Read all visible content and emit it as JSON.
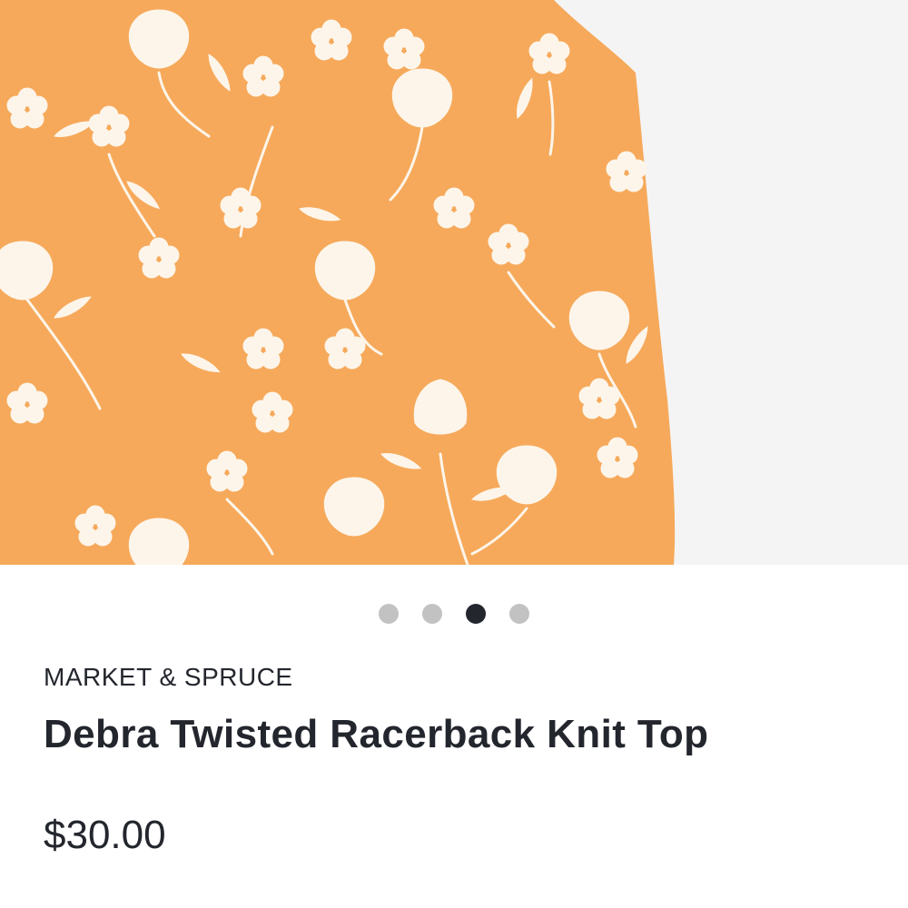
{
  "product_image": {
    "alt_subject": "orange floral print knit top",
    "fabric_color": "#f6a95a",
    "print_color": "#fdf5ea",
    "background_color": "#f4f4f4"
  },
  "carousel": {
    "total": 4,
    "active_index": 2
  },
  "product": {
    "brand": "MARKET & SPRUCE",
    "title": "Debra Twisted Racerback Knit Top",
    "price": "$30.00"
  },
  "colors": {
    "text": "#23262d",
    "dot_inactive": "#c2c2c2",
    "dot_active": "#23262d"
  }
}
